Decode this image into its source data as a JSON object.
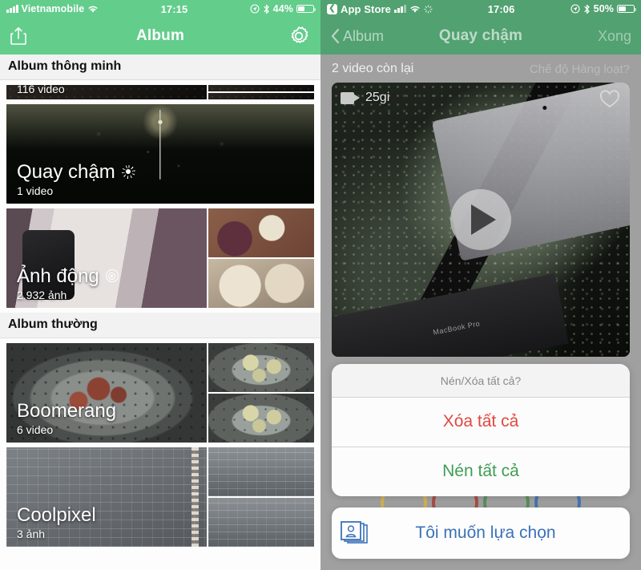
{
  "left": {
    "status": {
      "carrier": "Vietnamobile",
      "time": "17:15",
      "battery": "44%",
      "wifi_icon": "wifi-icon",
      "signal_icon": "cellular-signal-icon",
      "location_icon": "location-icon",
      "bluetooth_icon": "bluetooth-icon",
      "battery_icon": "battery-icon"
    },
    "nav": {
      "share_icon": "share-icon",
      "title": "Album",
      "settings_icon": "gear-icon"
    },
    "sections": [
      {
        "header": "Album thông minh",
        "albums": [
          {
            "title": "",
            "count": "116 video",
            "icon": "",
            "clipped": true
          },
          {
            "title": "Quay chậm",
            "count": "1 video",
            "icon": "slow-motion-icon",
            "clipped": false
          },
          {
            "title": "Ảnh động",
            "count": "2.932 ảnh",
            "icon": "live-photo-icon",
            "clipped": false
          }
        ]
      },
      {
        "header": "Album thường",
        "albums": [
          {
            "title": "Boomerang",
            "count": "6 video",
            "icon": "",
            "clipped": false
          },
          {
            "title": "Coolpixel",
            "count": "3 ảnh",
            "icon": "",
            "clipped": false
          }
        ]
      }
    ]
  },
  "right": {
    "status": {
      "back_app": "App Store",
      "time": "17:06",
      "battery": "50%",
      "wifi_icon": "wifi-icon",
      "signal_icon": "cellular-signal-icon",
      "spinner_icon": "activity-spinner-icon",
      "location_icon": "location-icon",
      "bluetooth_icon": "bluetooth-icon",
      "battery_icon": "battery-icon"
    },
    "nav": {
      "back_label": "Album",
      "back_icon": "chevron-left-icon",
      "title": "Quay chậm",
      "done_label": "Xong"
    },
    "sub": {
      "remaining": "2 video còn lại",
      "batch_mode": "Chế độ Hàng loạt?"
    },
    "video": {
      "badge": "25gi",
      "video_icon": "video-camera-icon",
      "favorite_icon": "heart-icon",
      "play_icon": "play-icon",
      "laptop_label": "MacBook Pro"
    },
    "sheet": {
      "title": "Nén/Xóa tất cả?",
      "actions": [
        {
          "label": "Xóa tất cả",
          "color": "#e0483f"
        },
        {
          "label": "Nén tất cả",
          "color": "#3f9d54"
        }
      ]
    },
    "bottom_button": {
      "label": "Tôi muốn lựa chọn",
      "icon": "photo-stack-icon",
      "color": "#3b72b8"
    },
    "rings": [
      "#d7b24a",
      "#a8443c",
      "#4f8f52",
      "#3f6fb0"
    ]
  },
  "theme": {
    "green_light": "#63cd8b",
    "green_dim": "#52a171",
    "overlay": "#9d9d9d"
  }
}
